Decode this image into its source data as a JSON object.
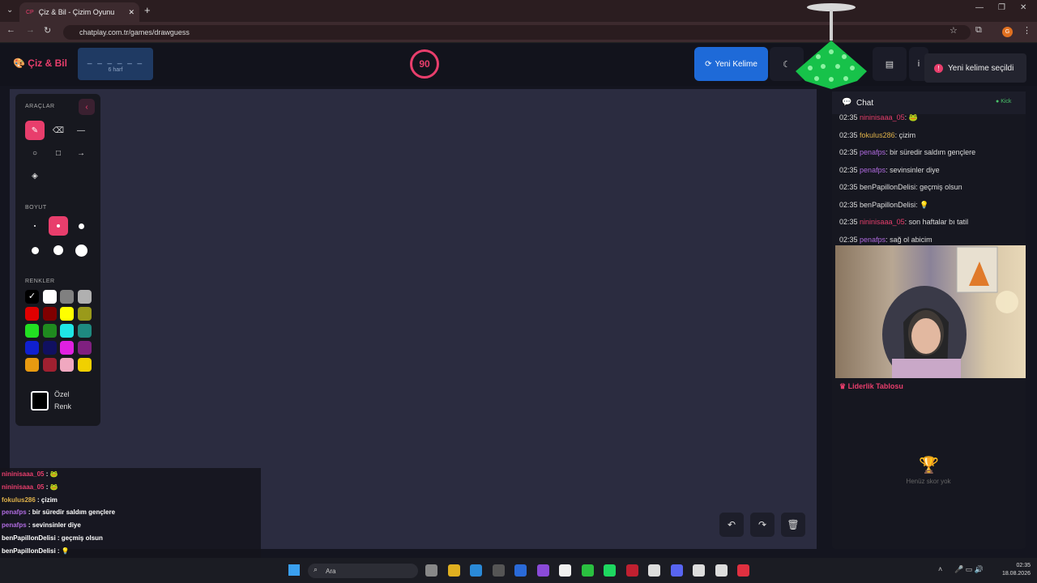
{
  "browser": {
    "tab_title": "Çiz & Bil - Çizim Oyunu",
    "url": "chatplay.com.tr/games/drawguess"
  },
  "header": {
    "logo": "Çiz & Bil",
    "word_mask": "_ _ _ _ _ _",
    "word_hint": "6 harf",
    "timer": "90",
    "new_word_label": "Yeni Kelime",
    "toast": "Yeni kelime seçildi"
  },
  "tools": {
    "title": "ARAÇLAR",
    "size_title": "BOYUT",
    "colors_title": "RENKLER",
    "custom_color": "Özel",
    "custom_color2": "Renk",
    "colors": [
      "#000000",
      "#ffffff",
      "#808080",
      "#b0b0b0",
      "#e00000",
      "#800000",
      "#ffff00",
      "#9a9a1a",
      "#22e022",
      "#1f8a1f",
      "#1fe5e5",
      "#1e8a80",
      "#1020d0",
      "#101060",
      "#e020e0",
      "#802080",
      "#e89a10",
      "#a02030",
      "#f0a8c0",
      "#f0d000"
    ]
  },
  "overlay_chat": [
    {
      "user": "nininisaaa_05",
      "msg": " : 🐸",
      "color": "#e83e6c"
    },
    {
      "user": "nininisaaa_05",
      "msg": " : 🐸",
      "color": "#e83e6c"
    },
    {
      "user": "fokulus286",
      "msg": " : çizim",
      "color": "#e0b24a"
    },
    {
      "user": "penafps",
      "msg": " : bir süredir saldım gençlere",
      "color": "#b06be0"
    },
    {
      "user": "penafps",
      "msg": " : sevinsinler diye",
      "color": "#b06be0"
    },
    {
      "user": "benPapillonDelisi",
      "msg": " : geçmiş olsun",
      "color": "#ffffff"
    },
    {
      "user": "benPapillonDelisi",
      "msg": " : 💡",
      "color": "#ffffff"
    },
    {
      "user": "nininisaaa_05",
      "msg": " : son haftalar bı tatil",
      "color": "#e83e6c"
    },
    {
      "user": "penafps",
      "msg": " : sağ ol abicim",
      "color": "#b06be0"
    }
  ],
  "chat": {
    "title": "Chat",
    "badge": "Kick",
    "messages": [
      {
        "time": "02:35",
        "user": "nininisaaa_05",
        "text": ": 🐸",
        "cls": "u1"
      },
      {
        "time": "02:35",
        "user": "fokulus286",
        "text": ": çizim",
        "cls": "u2"
      },
      {
        "time": "02:35",
        "user": "penafps",
        "text": ": bir süredir saldım gençlere",
        "cls": "u3"
      },
      {
        "time": "02:35",
        "user": "penafps",
        "text": ": sevinsinler diye",
        "cls": "u3"
      },
      {
        "time": "02:35",
        "user": "benPapillonDelisi",
        "text": ": geçmiş olsun",
        "cls": "u4"
      },
      {
        "time": "02:35",
        "user": "benPapillonDelisi",
        "text": ": 💡",
        "cls": "u4"
      },
      {
        "time": "02:35",
        "user": "nininisaaa_05",
        "text": ": son haftalar bı tatil",
        "cls": "u1"
      },
      {
        "time": "02:35",
        "user": "penafps",
        "text": ": sağ ol abicim",
        "cls": "u3"
      }
    ]
  },
  "leaderboard": {
    "title": "Liderlik Tablosu",
    "empty": "Henüz skor yok"
  },
  "taskbar": {
    "search": "Ara",
    "time": "02:35",
    "date": "18.08.2026"
  }
}
